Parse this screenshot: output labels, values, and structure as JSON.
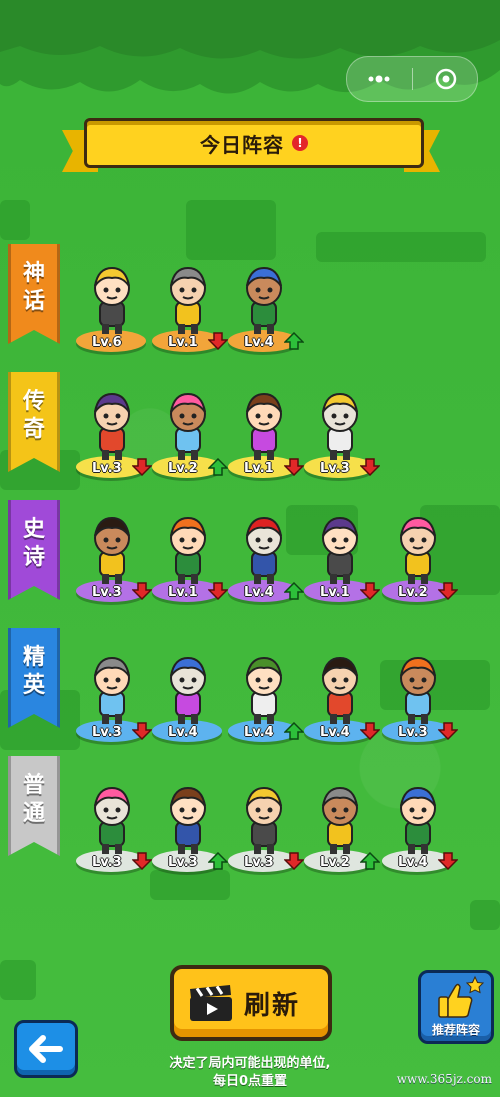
{
  "banner": {
    "title": "今日阵容",
    "info_icon": "!"
  },
  "top_capsule": {
    "menu_icon": "more-dots-icon",
    "close_icon": "target-circle-icon"
  },
  "tiers": [
    {
      "label": [
        "神",
        "话"
      ],
      "color": "#f08a1c",
      "units": [
        {
          "name": "blonde-swordsman",
          "level": "Lv.6",
          "change": "none",
          "pad": "#f2a53a"
        },
        {
          "name": "cat-eared-mage",
          "level": "Lv.1",
          "change": "down",
          "pad": "#f2a53a"
        },
        {
          "name": "barbarian-warrior",
          "level": "Lv.4",
          "change": "up",
          "pad": "#f2a53a"
        }
      ]
    },
    {
      "label": [
        "传",
        "奇"
      ],
      "color": "#f4c418",
      "units": [
        {
          "name": "cannon-tower",
          "level": "Lv.3",
          "change": "down",
          "pad": "#f6e04a"
        },
        {
          "name": "old-rifleman",
          "level": "Lv.2",
          "change": "up",
          "pad": "#f6e04a"
        },
        {
          "name": "panda-fighter",
          "level": "Lv.1",
          "change": "down",
          "pad": "#f6e04a"
        },
        {
          "name": "ghost-spirit",
          "level": "Lv.3",
          "change": "down",
          "pad": "#f6e04a"
        }
      ]
    },
    {
      "label": [
        "史",
        "诗"
      ],
      "color": "#a04ad8",
      "units": [
        {
          "name": "pink-mohawk-archer",
          "level": "Lv.3",
          "change": "down",
          "pad": "#b471e6"
        },
        {
          "name": "tree-sprout",
          "level": "Lv.1",
          "change": "down",
          "pad": "#b471e6"
        },
        {
          "name": "viking-brute",
          "level": "Lv.4",
          "change": "up",
          "pad": "#b471e6"
        },
        {
          "name": "jester-clown",
          "level": "Lv.1",
          "change": "down",
          "pad": "#b471e6"
        },
        {
          "name": "skull-butcher",
          "level": "Lv.2",
          "change": "down",
          "pad": "#b471e6"
        }
      ]
    },
    {
      "label": [
        "精",
        "英"
      ],
      "color": "#2a86e0",
      "units": [
        {
          "name": "shrine-maiden",
          "level": "Lv.3",
          "change": "down",
          "pad": "#5db3ef"
        },
        {
          "name": "bomb-creature",
          "level": "Lv.4",
          "change": "none",
          "pad": "#5db3ef"
        },
        {
          "name": "golden-knight",
          "level": "Lv.4",
          "change": "up",
          "pad": "#5db3ef"
        },
        {
          "name": "fire-fox",
          "level": "Lv.4",
          "change": "down",
          "pad": "#5db3ef"
        },
        {
          "name": "horned-demon-girl",
          "level": "Lv.3",
          "change": "down",
          "pad": "#5db3ef"
        }
      ]
    },
    {
      "label": [
        "普",
        "通"
      ],
      "color": "#c8c8c8",
      "units": [
        {
          "name": "elf-ranger",
          "level": "Lv.3",
          "change": "down",
          "pad": "#dfe6df"
        },
        {
          "name": "flame-head",
          "level": "Lv.3",
          "change": "up",
          "pad": "#dfe6df"
        },
        {
          "name": "hooded-spearman",
          "level": "Lv.3",
          "change": "down",
          "pad": "#dfe6df"
        },
        {
          "name": "armored-hammer-knight",
          "level": "Lv.2",
          "change": "up",
          "pad": "#dfe6df"
        },
        {
          "name": "pink-ram-girl",
          "level": "Lv.4",
          "change": "down",
          "pad": "#dfe6df"
        }
      ]
    }
  ],
  "buttons": {
    "refresh_label": "刷新",
    "recommend_label": "推荐阵容",
    "back_icon": "back-arrow-icon"
  },
  "note_lines": [
    "决定了局内可能出现的单位,",
    "每日0点重置"
  ],
  "watermark": "www.365jz.com",
  "colors": {
    "up_arrow": "#2dbf3a",
    "down_arrow": "#e02828",
    "accent": "#ffd21f"
  }
}
